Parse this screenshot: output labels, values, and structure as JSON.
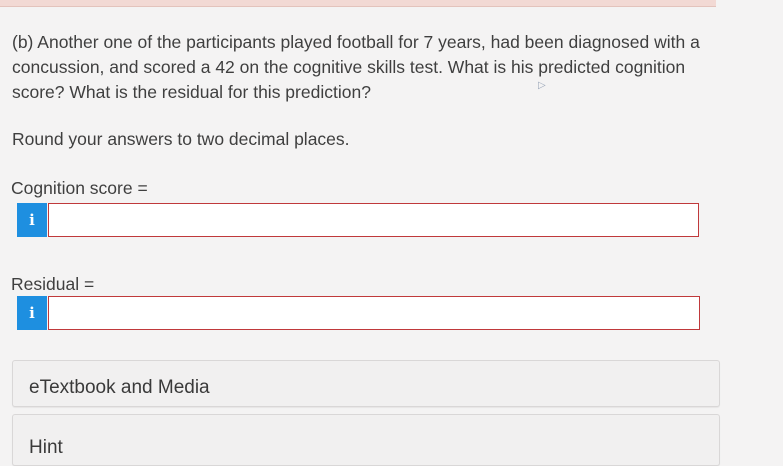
{
  "question": {
    "text": "(b) Another one of the participants played football for 7 years, had been diagnosed with a concussion, and scored a 42 on the cognitive skills test. What is his predicted cognition score? What is the residual for this prediction?",
    "instruction": "Round your answers to two decimal places."
  },
  "fields": {
    "cognition": {
      "label": "Cognition score =",
      "info_icon": "i",
      "value": ""
    },
    "residual": {
      "label": "Residual =",
      "info_icon": "i",
      "value": ""
    }
  },
  "panels": {
    "etextbook_label": "eTextbook and Media",
    "hint_label": "Hint"
  },
  "colors": {
    "info_button": "#1e8fe0",
    "input_border_error": "#c0393b"
  },
  "icons": [
    "info-icon",
    "mouse-cursor-icon"
  ]
}
